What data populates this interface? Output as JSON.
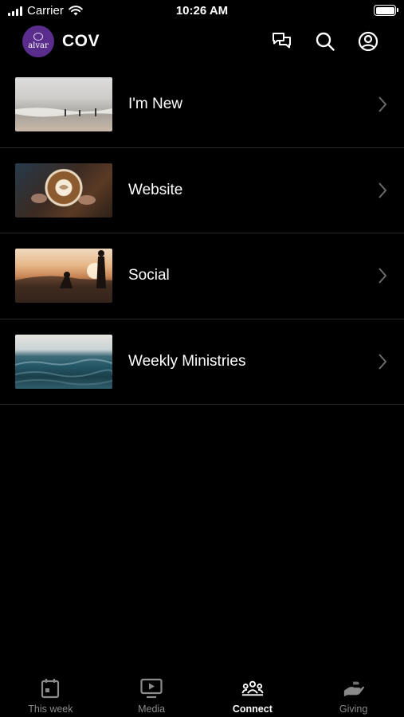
{
  "status_bar": {
    "carrier": "Carrier",
    "time": "10:26 AM"
  },
  "header": {
    "logo_text": "alvar",
    "title": "COV",
    "icons": [
      "chat-icon",
      "search-icon",
      "account-icon"
    ]
  },
  "list": {
    "items": [
      {
        "label": "I'm New",
        "thumbnail": "beach-photo"
      },
      {
        "label": "Website",
        "thumbnail": "coffee-photo"
      },
      {
        "label": "Social",
        "thumbnail": "sunset-people-photo"
      },
      {
        "label": "Weekly Ministries",
        "thumbnail": "ocean-waves-photo"
      }
    ]
  },
  "tab_bar": {
    "tabs": [
      {
        "label": "This week",
        "icon": "calendar-icon",
        "active": false
      },
      {
        "label": "Media",
        "icon": "play-screen-icon",
        "active": false
      },
      {
        "label": "Connect",
        "icon": "group-icon",
        "active": true
      },
      {
        "label": "Giving",
        "icon": "giving-hand-icon",
        "active": false
      }
    ]
  },
  "colors": {
    "background": "#000000",
    "text": "#ffffff",
    "inactive_tab": "#8a8a8a",
    "divider": "#2a2a2a",
    "logo_bg": "#5a2d8c"
  }
}
